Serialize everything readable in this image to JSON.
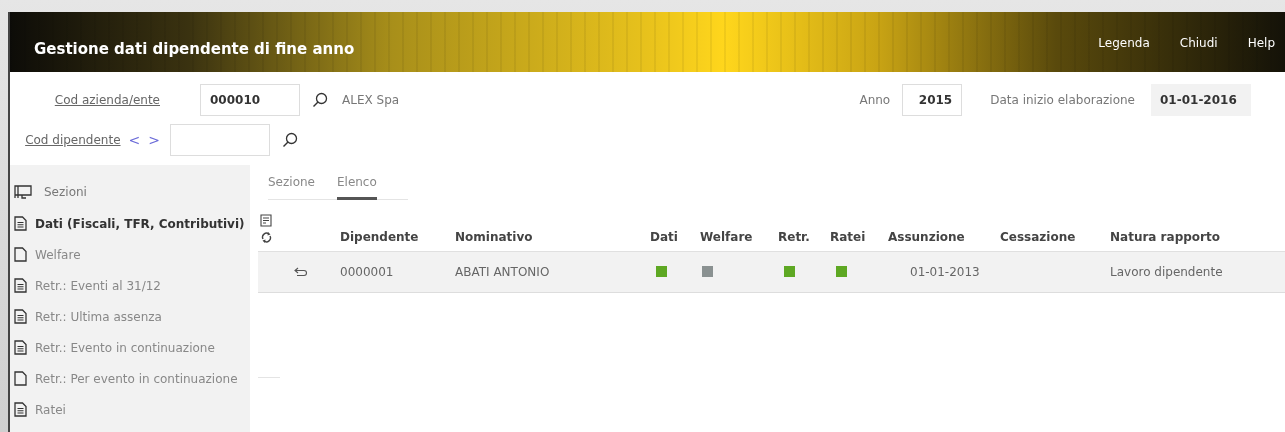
{
  "header": {
    "title": "Gestione dati dipendente di fine anno",
    "links": [
      "Legenda",
      "Chiudi",
      "Help"
    ]
  },
  "form": {
    "azienda": {
      "label": "Cod azienda/ente",
      "value": "000010",
      "name": "ALEX Spa"
    },
    "dipendente": {
      "label": "Cod dipendente",
      "prev": "<",
      "next": ">"
    },
    "anno": {
      "label": "Anno",
      "value": "2015"
    },
    "data_inizio": {
      "label": "Data inizio elaborazione",
      "value": "01-01-2016"
    }
  },
  "sidebar": {
    "title": "Sezioni",
    "items": [
      {
        "label": "Dati (Fiscali, TFR, Contributivi)",
        "selected": true,
        "kind": "filled"
      },
      {
        "label": "Welfare",
        "selected": false,
        "kind": "empty"
      },
      {
        "label": "Retr.: Eventi al 31/12",
        "selected": false,
        "kind": "filled"
      },
      {
        "label": "Retr.: Ultima assenza",
        "selected": false,
        "kind": "filled"
      },
      {
        "label": "Retr.: Evento in continuazione",
        "selected": false,
        "kind": "filled"
      },
      {
        "label": "Retr.: Per evento in continuazione",
        "selected": false,
        "kind": "empty"
      },
      {
        "label": "Ratei",
        "selected": false,
        "kind": "filled"
      }
    ]
  },
  "tabs": [
    {
      "label": "Sezione",
      "selected": false
    },
    {
      "label": "Elenco",
      "selected": true
    }
  ],
  "table": {
    "columns": [
      "Dipendente",
      "Nominativo",
      "Dati",
      "Welfare",
      "Retr.",
      "Ratei",
      "Assunzione",
      "Cessazione",
      "Natura rapporto"
    ],
    "rows": [
      {
        "dipendente": "0000001",
        "nominativo": "ABATI ANTONIO",
        "statuses": [
          {
            "color": "#5ea823"
          },
          {
            "color": "#8a9191"
          },
          {
            "color": "#5ea823"
          },
          {
            "color": "#5ea823"
          }
        ],
        "assunzione": "01-01-2013",
        "natura": "Lavoro dipendente"
      }
    ]
  }
}
